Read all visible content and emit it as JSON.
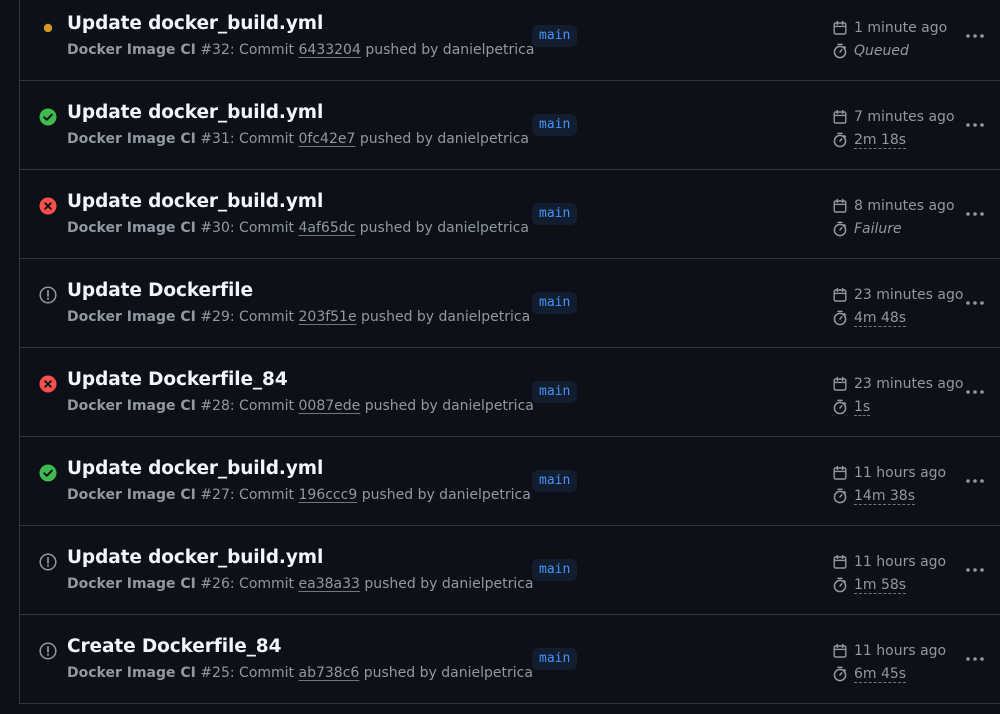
{
  "runs": [
    {
      "status": "queued",
      "title": "Update docker_build.yml",
      "workflow": "Docker Image CI",
      "run_number": "#32",
      "commit_label": ": Commit",
      "sha": "6433204",
      "pushed_by": "pushed by danielpetrica",
      "branch": "main",
      "time": "1 minute ago",
      "duration": "Queued",
      "duration_plain": true
    },
    {
      "status": "success",
      "title": "Update docker_build.yml",
      "workflow": "Docker Image CI",
      "run_number": "#31",
      "commit_label": ": Commit",
      "sha": "0fc42e7",
      "pushed_by": "pushed by danielpetrica",
      "branch": "main",
      "time": "7 minutes ago",
      "duration": "2m 18s",
      "duration_plain": false
    },
    {
      "status": "failure",
      "title": "Update docker_build.yml",
      "workflow": "Docker Image CI",
      "run_number": "#30",
      "commit_label": ": Commit",
      "sha": "4af65dc",
      "pushed_by": "pushed by danielpetrica",
      "branch": "main",
      "time": "8 minutes ago",
      "duration": "Failure",
      "duration_plain": true
    },
    {
      "status": "cancelled",
      "title": "Update Dockerfile",
      "workflow": "Docker Image CI",
      "run_number": "#29",
      "commit_label": ": Commit",
      "sha": "203f51e",
      "pushed_by": "pushed by danielpetrica",
      "branch": "main",
      "time": "23 minutes ago",
      "duration": "4m 48s",
      "duration_plain": false
    },
    {
      "status": "failure",
      "title": "Update Dockerfile_84",
      "workflow": "Docker Image CI",
      "run_number": "#28",
      "commit_label": ": Commit",
      "sha": "0087ede",
      "pushed_by": "pushed by danielpetrica",
      "branch": "main",
      "time": "23 minutes ago",
      "duration": "1s",
      "duration_plain": false
    },
    {
      "status": "success",
      "title": "Update docker_build.yml",
      "workflow": "Docker Image CI",
      "run_number": "#27",
      "commit_label": ": Commit",
      "sha": "196ccc9",
      "pushed_by": "pushed by danielpetrica",
      "branch": "main",
      "time": "11 hours ago",
      "duration": "14m 38s",
      "duration_plain": false
    },
    {
      "status": "cancelled",
      "title": "Update docker_build.yml",
      "workflow": "Docker Image CI",
      "run_number": "#26",
      "commit_label": ": Commit",
      "sha": "ea38a33",
      "pushed_by": "pushed by danielpetrica",
      "branch": "main",
      "time": "11 hours ago",
      "duration": "1m 58s",
      "duration_plain": false
    },
    {
      "status": "cancelled",
      "title": "Create Dockerfile_84",
      "workflow": "Docker Image CI",
      "run_number": "#25",
      "commit_label": ": Commit",
      "sha": "ab738c6",
      "pushed_by": "pushed by danielpetrica",
      "branch": "main",
      "time": "11 hours ago",
      "duration": "6m 45s",
      "duration_plain": false
    }
  ],
  "icons": {
    "queued": "dot-fill-icon",
    "success": "check-circle-fill-icon",
    "failure": "x-circle-fill-icon",
    "cancelled": "stop-icon",
    "time": "calendar-icon",
    "duration": "stopwatch-icon",
    "more": "kebab-horizontal-icon"
  },
  "colors": {
    "queued": "#d29922",
    "success": "#3fb950",
    "failure": "#f85149",
    "cancelled": "#9198a1",
    "branch_text": "#4493f8",
    "branch_bg": "#121d2f"
  }
}
